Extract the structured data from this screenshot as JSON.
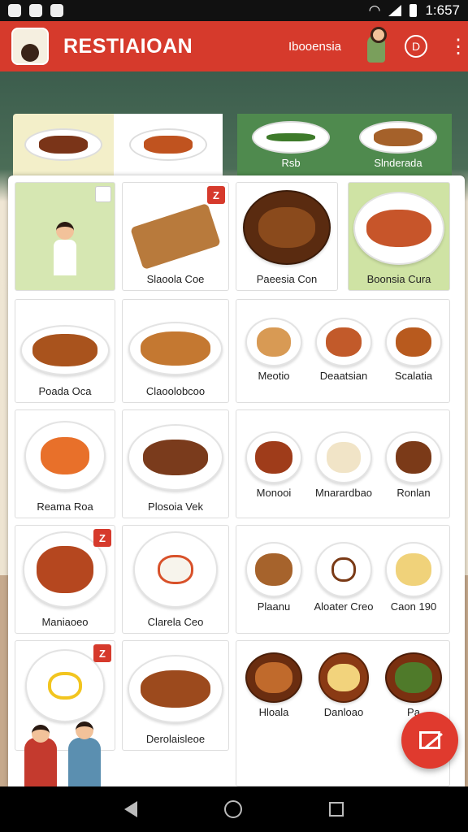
{
  "status_bar": {
    "time": "1:657"
  },
  "app_bar": {
    "title": "RESTIAIOAN",
    "subtitle": "Ibooensia",
    "d_label": "D",
    "menu_glyph": "⋮"
  },
  "top_strip": [
    {
      "label": ""
    },
    {
      "label": ""
    },
    {
      "label": "Rsb"
    },
    {
      "label": "Slnderada"
    }
  ],
  "left_cards": [
    {
      "label": "",
      "badge": ""
    },
    {
      "label": "Slaoola Coe",
      "badge": "Z"
    },
    {
      "label": "Poada Oca",
      "badge": ""
    },
    {
      "label": "Claoolobcoo",
      "badge": ""
    },
    {
      "label": "Reama Roa",
      "badge": ""
    },
    {
      "label": "Plosoia Vek",
      "badge": ""
    },
    {
      "label": "Maniaoeo",
      "badge": "Z"
    },
    {
      "label": "Clarela Ceo",
      "badge": ""
    },
    {
      "label": "",
      "badge": "Z"
    },
    {
      "label": "Derolaisleoe",
      "badge": ""
    }
  ],
  "right_top_cards": [
    {
      "label": "Paeesia Con"
    },
    {
      "label": "Boonsia Cura"
    }
  ],
  "right_groups": [
    {
      "items": [
        "Meotio",
        "Deaatsian",
        "Scalatia"
      ]
    },
    {
      "items": [
        "Monooi",
        "Mnarardbao",
        "Ronlan"
      ]
    },
    {
      "items": [
        "Plaanu",
        "Aloater Creo",
        "Caon 190"
      ]
    },
    {
      "items": [
        "Hloala",
        "Danloao",
        "Pa"
      ]
    }
  ],
  "colors": {
    "brand_red": "#d63a2c",
    "accent_green": "#4f8a4e"
  },
  "icons": [
    "gear-icon",
    "menu-icon",
    "edit-icon",
    "back-icon",
    "home-icon",
    "recents-icon"
  ]
}
